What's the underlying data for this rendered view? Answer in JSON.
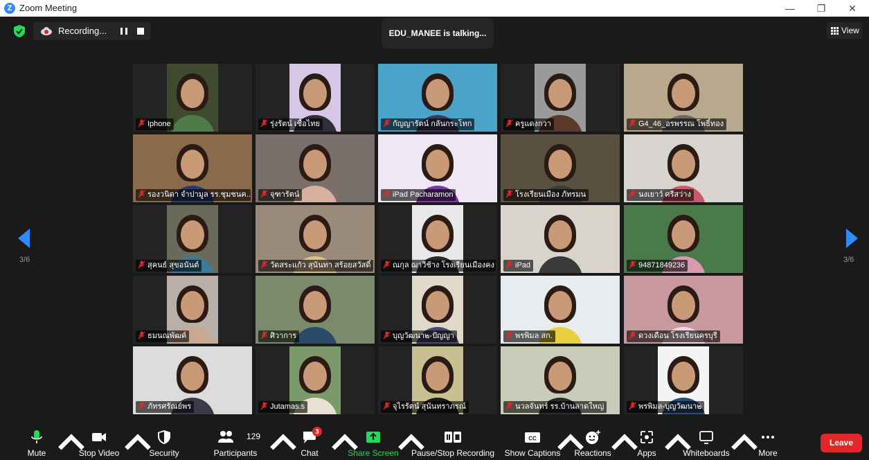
{
  "window": {
    "title": "Zoom Meeting",
    "logo_letter": "Z"
  },
  "top": {
    "recording_label": "Recording...",
    "talking_text": "EDU_MANEE is talking...",
    "view_label": "View"
  },
  "pagination": {
    "left": "3/6",
    "right": "3/6"
  },
  "tiles": [
    {
      "name": "Iphone",
      "bg": "#3f4a2f",
      "shirt": "#4f7a4a"
    },
    {
      "name": "รุ่งรัตน์ เชื้อไทย",
      "bg": "#d7c7e6",
      "shirt": "#2f2f3a"
    },
    {
      "name": "กัญญารัตน์ กลันกระโทก",
      "bg": "#4aa3c8",
      "shirt": "#3a3a5a"
    },
    {
      "name": "ครูแดงกวา",
      "bg": "#9a9a9a",
      "shirt": "#5a3a2a"
    },
    {
      "name": "G4_46_อรพรรณ โพธิ์ทอง",
      "bg": "#b8a98e",
      "shirt": "#6a6a6a"
    },
    {
      "name": "รองวนิดา จำปามูล รร.ชุมชนค...",
      "bg": "#8a6a4a",
      "shirt": "#2a3a6a"
    },
    {
      "name": "จุฑารัตน์",
      "bg": "#7a6f6a",
      "shirt": "#d8b0a0"
    },
    {
      "name": "iPad Pacharamon",
      "bg": "#efe8f4",
      "shirt": "#7a3a9a"
    },
    {
      "name": "โรงเรียนเมือง ภัทรมน",
      "bg": "#5a5040",
      "shirt": "#3a3a3a"
    },
    {
      "name": "นงเยาว์ ศรีสว่าง",
      "bg": "#d8d4d0",
      "shirt": "#c85a6a"
    },
    {
      "name": "สุคนธ์ สุขอนันต์",
      "bg": "#6a6a5a",
      "shirt": "#3a7a9a"
    },
    {
      "name": "วัดสระแก้ว สุนันทา สร้อยสวัสดิ์",
      "bg": "#9a8a7a",
      "shirt": "#d8c090"
    },
    {
      "name": "ณกุล ฌาวีช้าง โรงเรียนเมืองคง",
      "bg": "#e8e8ea",
      "shirt": "#2a2a2a"
    },
    {
      "name": "iPad",
      "bg": "#d8d4cc",
      "shirt": "#3a3a3a"
    },
    {
      "name": "94871849236",
      "bg": "#4a7a4a",
      "shirt": "#d89ab0"
    },
    {
      "name": "ธมนณพัฒค์",
      "bg": "#b8b0a8",
      "shirt": "#caa890"
    },
    {
      "name": "ศิวาการ",
      "bg": "#7a8a6a",
      "shirt": "#2a4a6a"
    },
    {
      "name": "บุญวัฒนา๒-ปัญญา",
      "bg": "#e0d8c8",
      "shirt": "#4a4a6a"
    },
    {
      "name": "พรพิมล สก.",
      "bg": "#e8ecef",
      "shirt": "#e8d040"
    },
    {
      "name": "ดวงเดือน โรงเรียนครบุรี",
      "bg": "#c89aa0",
      "shirt": "#f0d8e0"
    },
    {
      "name": "ภัทรศรัณย์พร",
      "bg": "#dcdcdc",
      "shirt": "#3a3a4a"
    },
    {
      "name": "Jutamas.s",
      "bg": "#7a9a6a",
      "shirt": "#e8e0d0"
    },
    {
      "name": "จุไรรัตน์ สุนันทราภรณ์",
      "bg": "#c8c090",
      "shirt": "#1a1a1a"
    },
    {
      "name": "นวลจันทร์ รร.บ้านลาดใหญ่",
      "bg": "#c8ccb8",
      "shirt": "#2a2a2a"
    },
    {
      "name": "พรพิมล-บุญวัฒนา๒",
      "bg": "#f4f4f4",
      "shirt": "#2a4a7a"
    }
  ],
  "toolbar": {
    "mute": "Mute",
    "stop_video": "Stop Video",
    "security": "Security",
    "participants": "Participants",
    "participant_count": "129",
    "chat": "Chat",
    "chat_badge": "3",
    "share_screen": "Share Screen",
    "pause_stop_recording": "Pause/Stop Recording",
    "show_captions": "Show Captions",
    "reactions": "Reactions",
    "apps": "Apps",
    "whiteboards": "Whiteboards",
    "more": "More",
    "leave": "Leave"
  },
  "colors": {
    "accent": "#2d8cff",
    "leave": "#e02828",
    "share": "#23d959",
    "muted_icon": "#e02828"
  },
  "icons": [
    "zoom-logo-icon",
    "shield-icon",
    "cloud-record-icon",
    "pause-icon",
    "stop-icon",
    "grid-view-icon",
    "mic-muted-icon",
    "microphone-icon",
    "video-camera-icon",
    "security-shield-icon",
    "participants-icon",
    "chat-icon",
    "share-screen-icon",
    "captions-icon",
    "reactions-icon",
    "apps-icon",
    "whiteboard-icon",
    "more-icon"
  ]
}
